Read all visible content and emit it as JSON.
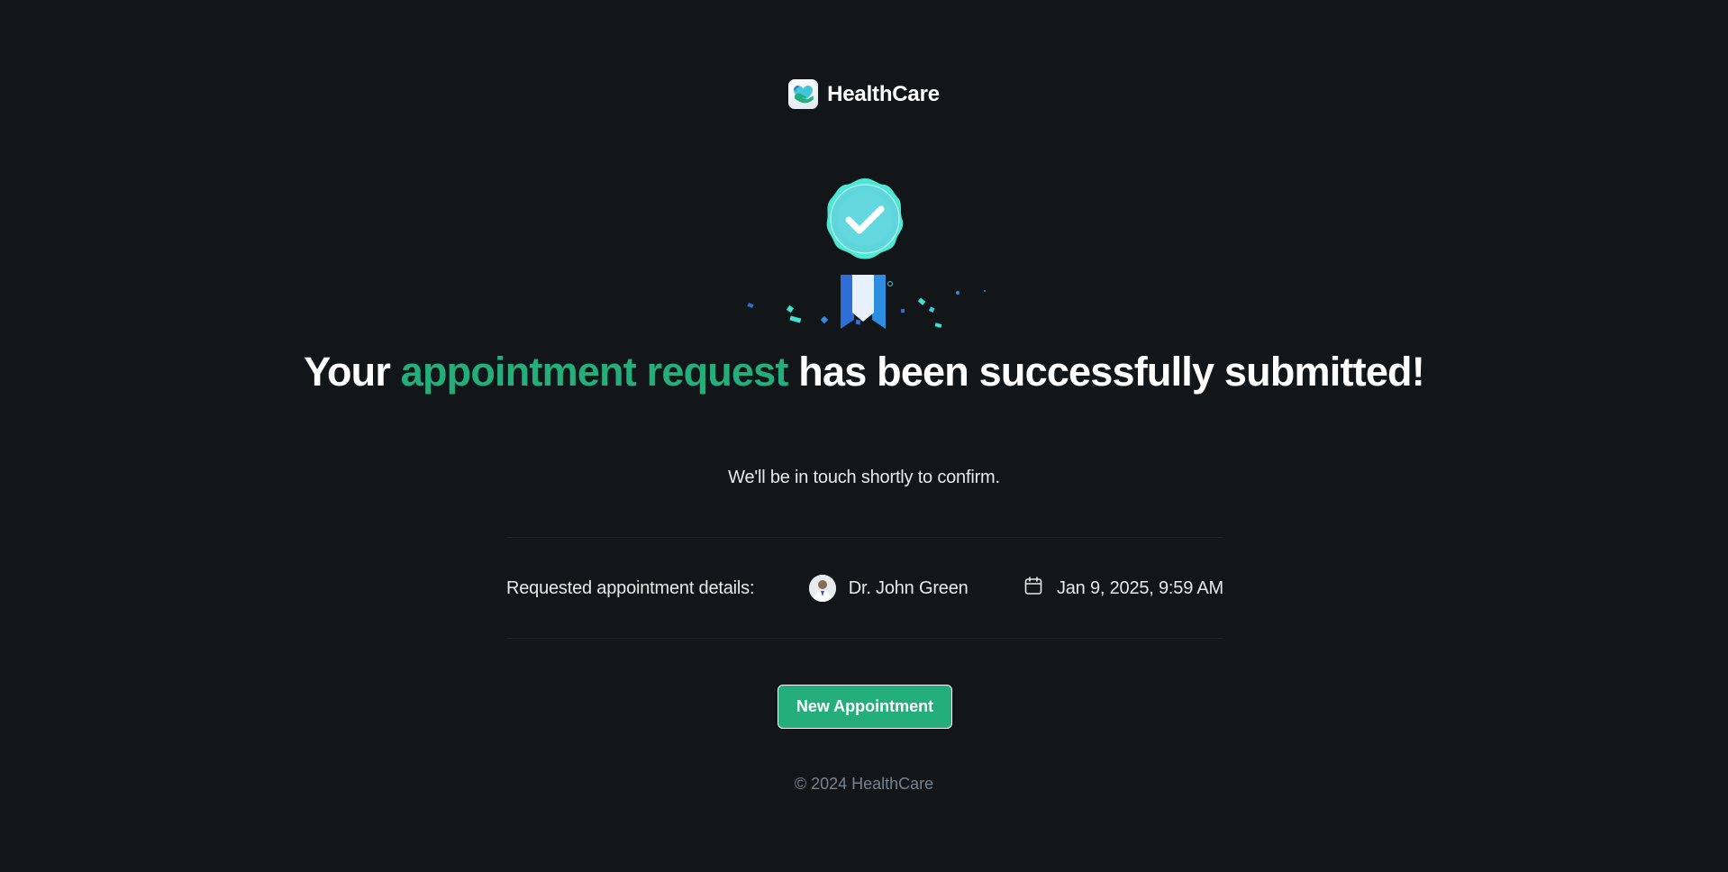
{
  "brand": {
    "name": "HealthCare",
    "logo_icon": "heart-hands-logo",
    "accent_color": "#24ae7c"
  },
  "success": {
    "badge_icon": "success-badge-icon",
    "headline_part1": "Your ",
    "headline_accent": "appointment request",
    "headline_part2": " has been successfully submitted!",
    "subtext": "We'll be in touch shortly to confirm."
  },
  "details": {
    "label": "Requested appointment details:",
    "doctor_name": "Dr. John Green",
    "datetime": "Jan 9, 2025, 9:59 AM",
    "calendar_icon": "calendar-icon"
  },
  "actions": {
    "new_appointment_label": "New Appointment"
  },
  "footer": {
    "copyright": "© 2024 HealthCare"
  }
}
